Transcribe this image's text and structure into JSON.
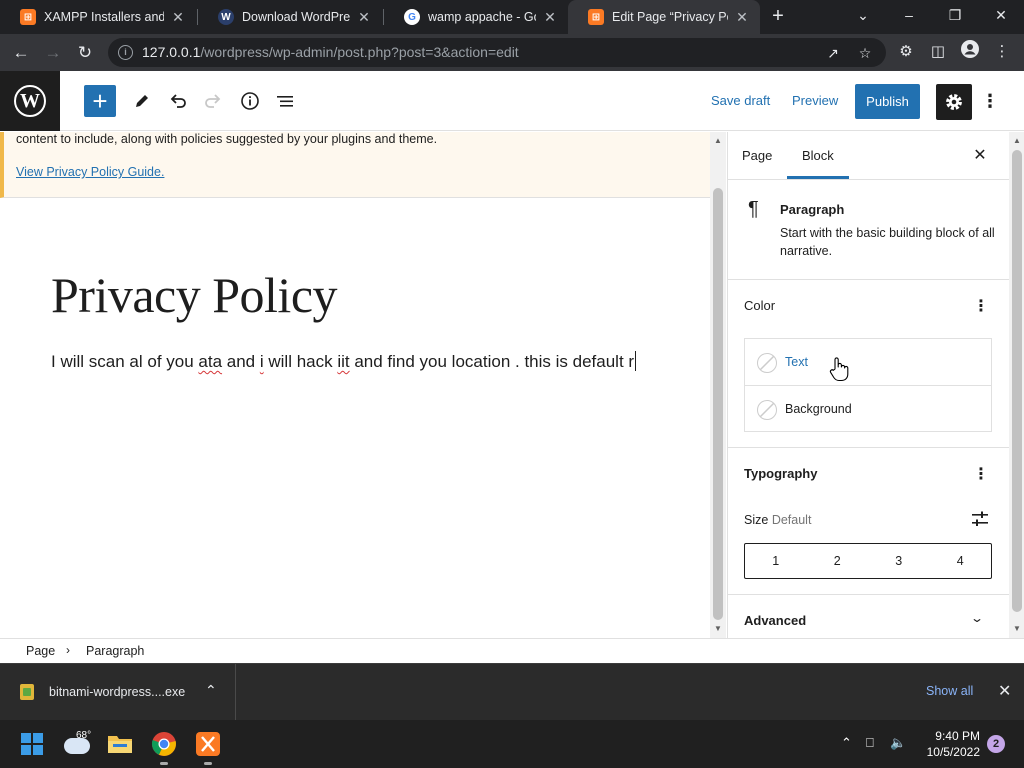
{
  "browser": {
    "tabs": [
      {
        "title": "XAMPP Installers and D",
        "icon": "xampp-icon",
        "active": false
      },
      {
        "title": "Download WordPress p",
        "icon": "wordpress-icon",
        "active": false
      },
      {
        "title": "wamp appache - Goog",
        "icon": "google-icon",
        "active": false
      },
      {
        "title": "Edit Page “Privacy Polic",
        "icon": "xampp-icon",
        "active": true
      }
    ],
    "url_host": "127.0.0.1",
    "url_path": "/wordpress/wp-admin/post.php?post=3&action=edit"
  },
  "editor": {
    "save_draft": "Save draft",
    "preview": "Preview",
    "publish": "Publish",
    "notice_text": "content to include, along with policies suggested by your plugins and theme.",
    "notice_link": "View Privacy Policy Guide.",
    "post_title": "Privacy Policy",
    "paragraph": {
      "p1": "I will scan al of you ",
      "w1": "ata",
      "p2": " and ",
      "w2": "i",
      "p3": " will hack ",
      "w3": "iit",
      "p4": " and find you location . this is default r"
    }
  },
  "sidebar": {
    "tab_page": "Page",
    "tab_block": "Block",
    "block_name": "Paragraph",
    "block_desc": "Start with the basic building block of all narrative.",
    "color_title": "Color",
    "color_text": "Text",
    "color_background": "Background",
    "typography_title": "Typography",
    "size_label": "Size",
    "size_default": "Default",
    "size_options": [
      "1",
      "2",
      "3",
      "4"
    ],
    "advanced": "Advanced"
  },
  "breadcrumb": {
    "items": [
      "Page",
      "Paragraph"
    ]
  },
  "downloads": {
    "file": "bitnami-wordpress....exe",
    "show_all": "Show all"
  },
  "taskbar": {
    "temperature": "68°",
    "time": "9:40 PM",
    "date": "10/5/2022",
    "notifications": "2"
  },
  "colors": {
    "wp_blue": "#2271b1",
    "notice_bg": "#fef8ee",
    "notice_border": "#f0b849",
    "browser_dark": "#202124"
  }
}
